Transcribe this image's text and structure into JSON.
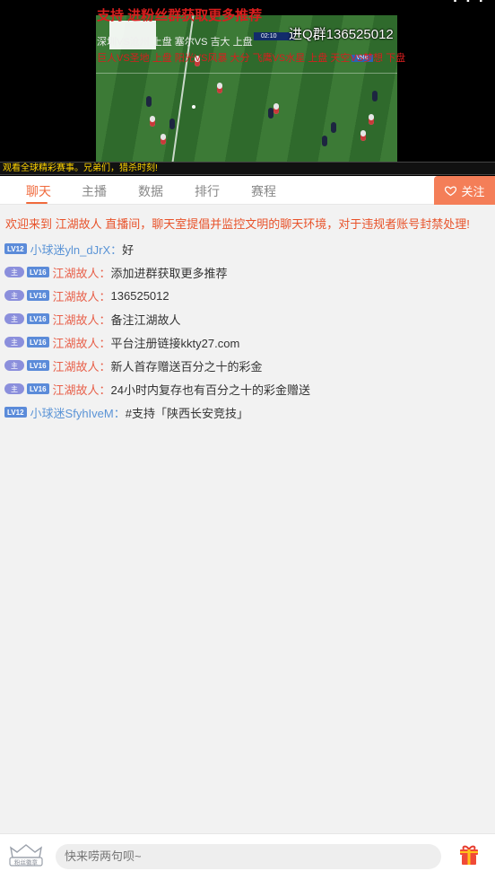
{
  "video": {
    "promo_top": "支持 进粉丝群获取更多推荐",
    "promo_qq": "进Q群136525012",
    "match_line_1": "深圳VS沧州 上盘 塞尔VS 吉大 上盘",
    "match_line_2": "巨人VS圣地 上盘 阳光VS风暴 大分  飞鹰VS水星 上盘 天空VS梦想 下盘",
    "scorebug": "02:10",
    "ticker": "观看全球精彩赛事。兄弟们，猎杀时刻!"
  },
  "tabs": [
    {
      "label": "聊天",
      "active": true
    },
    {
      "label": "主播",
      "active": false
    },
    {
      "label": "数据",
      "active": false
    },
    {
      "label": "排行",
      "active": false
    },
    {
      "label": "赛程",
      "active": false
    }
  ],
  "follow_label": "关注",
  "welcome": "欢迎来到 江湖故人 直播间，聊天室提倡并监控文明的聊天环境，对于违规者账号封禁处理!",
  "messages": [
    {
      "room_badge": false,
      "level": "LV12",
      "user": "小球迷yln_dJrX：",
      "user_color": "blue",
      "text": "好"
    },
    {
      "room_badge": true,
      "room_label": "主",
      "level": "LV16",
      "user": "江湖故人：",
      "user_color": "red",
      "text": "添加进群获取更多推荐"
    },
    {
      "room_badge": true,
      "room_label": "主",
      "level": "LV16",
      "user": "江湖故人：",
      "user_color": "red",
      "text": "136525012"
    },
    {
      "room_badge": true,
      "room_label": "主",
      "level": "LV16",
      "user": "江湖故人：",
      "user_color": "red",
      "text": "备注江湖故人"
    },
    {
      "room_badge": true,
      "room_label": "主",
      "level": "LV16",
      "user": "江湖故人：",
      "user_color": "red",
      "text": "平台注册链接kkty27.com"
    },
    {
      "room_badge": true,
      "room_label": "主",
      "level": "LV16",
      "user": "江湖故人：",
      "user_color": "red",
      "text": "新人首存赠送百分之十的彩金"
    },
    {
      "room_badge": true,
      "room_label": "主",
      "level": "LV16",
      "user": "江湖故人：",
      "user_color": "red",
      "text": "24小时内复存也有百分之十的彩金赠送"
    },
    {
      "room_badge": false,
      "level": "LV12",
      "user": "小球迷SfyhIveM：",
      "user_color": "blue",
      "text": "#支持「陕西长安竞技」"
    }
  ],
  "bottom": {
    "fan_badge_label": "粉丝徽章",
    "input_placeholder": "快来唠两句呗~"
  },
  "colors": {
    "accent": "#f06a3c",
    "follow_bg": "#f47e58",
    "name_blue": "#5b94d6",
    "name_red": "#e8604a",
    "level_badge": "#5b8bd9",
    "room_badge": "#8b8fdc"
  },
  "icons": {
    "follow": "heart-outline-icon",
    "fan_badge": "crown-badge-icon",
    "gift": "gift-box-icon"
  }
}
